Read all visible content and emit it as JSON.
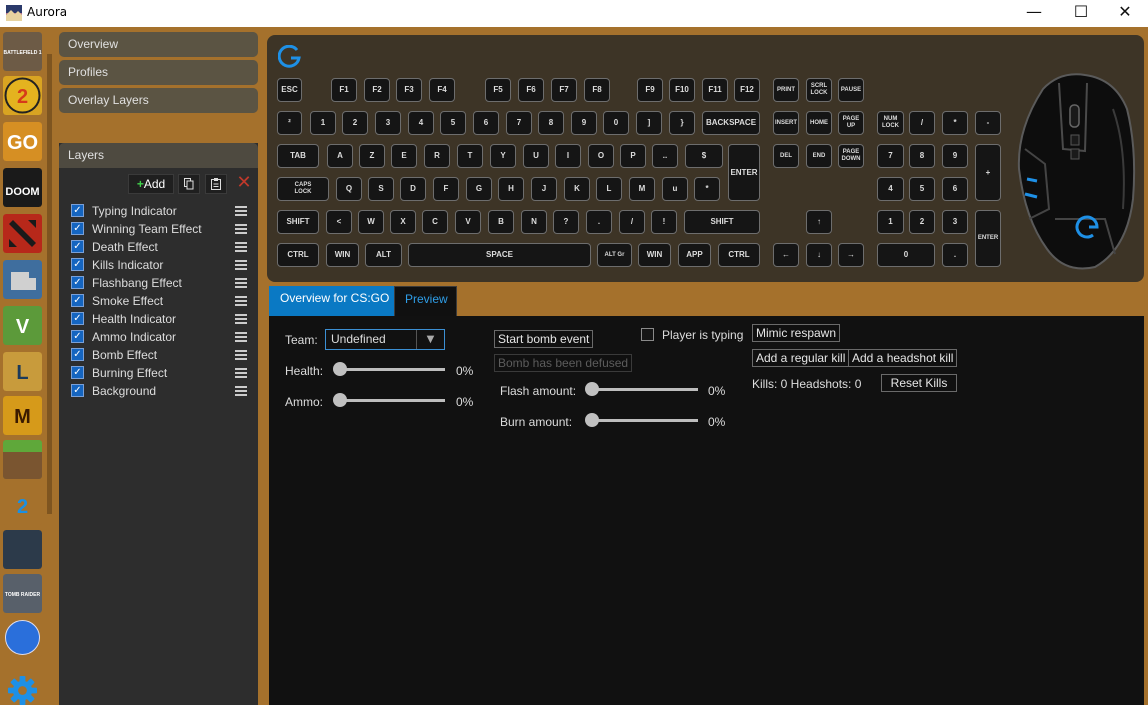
{
  "window": {
    "title": "Aurora",
    "minimize": "—",
    "maximize": "☐",
    "close": "✕"
  },
  "games": [
    {
      "name": "battlefield-1",
      "label": "BATTLEFIELD 1",
      "color": "#6d5b46"
    },
    {
      "name": "borderlands-2",
      "label": "2",
      "color": "#d9a422"
    },
    {
      "name": "csgo",
      "label": "GO",
      "color": "#d68f23"
    },
    {
      "name": "doom",
      "label": "DOOM",
      "color": "#ffffff"
    },
    {
      "name": "dota-2",
      "label": "",
      "color": "#b7281a"
    },
    {
      "name": "euro-truck-simulator-2",
      "label": "",
      "color": "#3f6e9e"
    },
    {
      "name": "gta-v",
      "label": "V",
      "color": "#5c9a3a"
    },
    {
      "name": "league-of-legends",
      "label": "L",
      "color": "#c89b3c"
    },
    {
      "name": "mafia",
      "label": "M",
      "color": "#d69a1a"
    },
    {
      "name": "minecraft",
      "label": "",
      "color": "#6a8e3c"
    },
    {
      "name": "payday-2",
      "label": "2",
      "color": "#1a8fe3"
    },
    {
      "name": "rainbow-six-siege",
      "label": "",
      "color": "#2c3a4a"
    },
    {
      "name": "tomb-raider",
      "label": "TOMB RAIDER",
      "color": "#58606a"
    },
    {
      "name": "rocket-league",
      "label": "",
      "color": "#2a6fdb"
    }
  ],
  "sidebar": {
    "items": [
      "Overview",
      "Profiles",
      "Overlay Layers"
    ],
    "layers_title": "Layers",
    "add_label": "Add",
    "layers": [
      "Typing Indicator",
      "Winning Team Effect",
      "Death Effect",
      "Kills Indicator",
      "Flashbang Effect",
      "Smoke Effect",
      "Health Indicator",
      "Ammo Indicator",
      "Bomb Effect",
      "Burning Effect",
      "Background"
    ]
  },
  "keyboard": {
    "keys": [
      "ESC",
      "F1",
      "F2",
      "F3",
      "F4",
      "F5",
      "F6",
      "F7",
      "F8",
      "F9",
      "F10",
      "F11",
      "F12",
      "PRINT",
      "SCRL\nLOCK",
      "PAUSE",
      "²",
      "1",
      "2",
      "3",
      "4",
      "5",
      "6",
      "7",
      "8",
      "9",
      "0",
      "]",
      "}",
      "BACKSPACE",
      "INSERT",
      "HOME",
      "PAGE\nUP",
      "NUM\nLOCK",
      "/",
      "*",
      "-",
      "TAB",
      "A",
      "Z",
      "E",
      "R",
      "T",
      "Y",
      "U",
      "I",
      "O",
      "P",
      "..",
      "$",
      "ENTER",
      "DEL",
      "END",
      "PAGE\nDOWN",
      "7",
      "8",
      "9",
      "+",
      "CAPS\nLOCK",
      "Q",
      "S",
      "D",
      "F",
      "G",
      "H",
      "J",
      "K",
      "L",
      "M",
      "u",
      "*",
      "4",
      "5",
      "6",
      "SHIFT",
      "<",
      "W",
      "X",
      "C",
      "V",
      "B",
      "N",
      "?",
      ".",
      "/",
      "!",
      "SHIFT",
      "↑",
      "1",
      "2",
      "3",
      "ENTER",
      "CTRL",
      "WIN",
      "ALT",
      "SPACE",
      "ALT Gr",
      "WIN",
      "APP",
      "CTRL",
      "←",
      "↓",
      "→",
      "0",
      "."
    ]
  },
  "tabs": {
    "overview": "Overview for CS:GO",
    "preview": "Preview"
  },
  "controls": {
    "team_label": "Team:",
    "team_value": "Undefined",
    "health_label": "Health:",
    "health_value": "0%",
    "ammo_label": "Ammo:",
    "ammo_value": "0%",
    "start_bomb": "Start bomb event",
    "bomb_defused": "Bomb has been defused",
    "flash_label": "Flash amount:",
    "flash_value": "0%",
    "burn_label": "Burn amount:",
    "burn_value": "0%",
    "player_typing": "Player is typing",
    "mimic_respawn": "Mimic respawn",
    "add_regular_kill": "Add a regular kill",
    "add_headshot_kill": "Add a headshot kill",
    "kills_text": "Kills: 0 Headshots: 0",
    "reset_kills": "Reset Kills"
  }
}
